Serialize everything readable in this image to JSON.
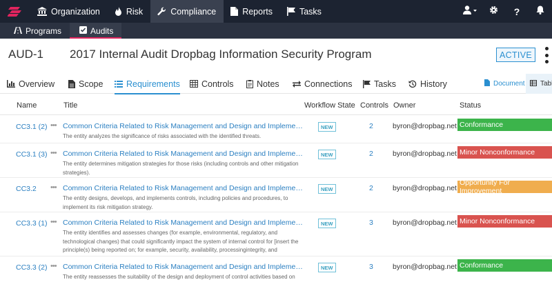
{
  "topnav": {
    "items": [
      {
        "label": "Organization",
        "icon": "bank-icon"
      },
      {
        "label": "Risk",
        "icon": "flame-icon"
      },
      {
        "label": "Compliance",
        "icon": "wrench-icon",
        "active": true
      },
      {
        "label": "Reports",
        "icon": "document-icon"
      },
      {
        "label": "Tasks",
        "icon": "flag-icon"
      }
    ],
    "right_icons": [
      "user-icon",
      "gear-icon",
      "help-icon",
      "bell-icon"
    ]
  },
  "subnav": {
    "items": [
      {
        "label": "Programs",
        "icon": "road-icon"
      },
      {
        "label": "Audits",
        "icon": "checkbox-icon",
        "active": true
      }
    ]
  },
  "header": {
    "audit_id": "AUD-1",
    "title": "2017 Internal Audit Dropbag Information Security Program",
    "status": "ACTIVE"
  },
  "tabs": [
    {
      "label": "Overview",
      "icon": "chart-icon"
    },
    {
      "label": "Scope",
      "icon": "file-icon"
    },
    {
      "label": "Requirements",
      "icon": "list-icon",
      "active": true
    },
    {
      "label": "Controls",
      "icon": "grid-icon"
    },
    {
      "label": "Notes",
      "icon": "note-icon"
    },
    {
      "label": "Connections",
      "icon": "exchange-icon"
    },
    {
      "label": "Tasks",
      "icon": "flag-icon"
    },
    {
      "label": "History",
      "icon": "history-icon"
    }
  ],
  "view_buttons": {
    "document": "Document",
    "table": "Tabl"
  },
  "table": {
    "columns": [
      "Name",
      "Title",
      "Workflow State",
      "Controls",
      "Owner",
      "Status"
    ],
    "rows": [
      {
        "name": "CC3.1 (2)",
        "title": "Common Criteria Related to Risk Management and Design and Implementation...",
        "desc": "The entity analyzes the significance of risks associated with the identified threats.",
        "workflow": "NEW",
        "controls": "2",
        "owner": "byron@dropbag.net",
        "status": "Conformance",
        "status_color": "#3cb44b"
      },
      {
        "name": "CC3.1 (3)",
        "title": "Common Criteria Related to Risk Management and Design and Implementation...",
        "desc": "The entity determines mitigation strategies for those risks (including controls and other mitigation strategies).",
        "workflow": "NEW",
        "controls": "2",
        "owner": "byron@dropbag.net",
        "status": "Minor Nonconformance",
        "status_color": "#d9534f"
      },
      {
        "name": "CC3.2",
        "title": "Common Criteria Related to Risk Management and Design and Implementation...",
        "desc": "The entity designs, develops, and implements controls, including policies and procedures, to implement its risk mitigation strategy.",
        "workflow": "NEW",
        "controls": "2",
        "owner": "byron@dropbag.net",
        "status": "Opportunity For Improvement",
        "status_color": "#f0ad4e"
      },
      {
        "name": "CC3.3 (1)",
        "title": "Common Criteria Related to Risk Management and Design and Implementation...",
        "desc": "The entity identifies and assesses changes (for example, environmental, regulatory, and technological changes) that could significantly impact the system of internal control for [insert the principle(s) being reported on; for example, security, availability, processingintegrity, and",
        "workflow": "NEW",
        "controls": "3",
        "owner": "byron@dropbag.net",
        "status": "Minor Nonconformance",
        "status_color": "#d9534f"
      },
      {
        "name": "CC3.3 (2)",
        "title": "Common Criteria Related to Risk Management and Design and Implementation...",
        "desc": "The entity reassesses the suitability of the design and deployment of control activities based on",
        "workflow": "NEW",
        "controls": "3",
        "owner": "byron@dropbag.net",
        "status": "Conformance",
        "status_color": "#3cb44b"
      }
    ]
  }
}
